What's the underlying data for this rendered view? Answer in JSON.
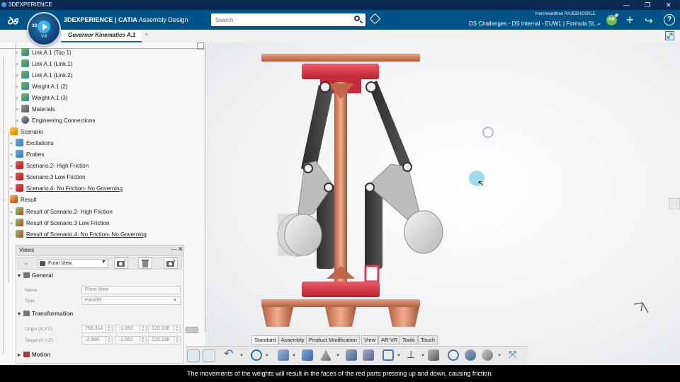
{
  "window": {
    "app_title": "3DEXPERIENCE",
    "minimize": "—",
    "restore": "❐",
    "close": "✕"
  },
  "header": {
    "compass_label": "3D",
    "compass_version": "V.6",
    "brand_prefix": "3DEXPERIENCE | CATIA",
    "brand_app": "Assembly Design",
    "search_placeholder": "Search",
    "user_name": "Harshwardhan RAJEBHOSRLE",
    "collab_space": "DS Challenges - DS Internal - EUW1 | Formula St...",
    "avatar_initials": "HR",
    "add_label": "+",
    "share_label": "↪",
    "help_label": "?"
  },
  "tabs": {
    "document_tab": "Governor Kinematics A.1",
    "add_tab": "+"
  },
  "tree": {
    "items": [
      {
        "label": "Link A.1 (Top 1)",
        "icon": "part"
      },
      {
        "label": "Link A.1 (Link.1)",
        "icon": "part"
      },
      {
        "label": "Link A.1 (Link.2)",
        "icon": "part"
      },
      {
        "label": "Weight A.1 (2)",
        "icon": "part"
      },
      {
        "label": "Weight A.1 (3)",
        "icon": "part"
      },
      {
        "label": "Materials",
        "icon": "materials"
      },
      {
        "label": "Engineering Connections",
        "icon": "engineering-connections"
      },
      {
        "label": "Scenario",
        "icon": "scenario"
      },
      {
        "label": "Excitations",
        "icon": "excitations"
      },
      {
        "label": "Probes",
        "icon": "probes"
      },
      {
        "label": "Scenario.2- High Friction",
        "icon": "scenario-item"
      },
      {
        "label": "Scenario.3 Low Friction",
        "icon": "scenario-item"
      },
      {
        "label": "Scenario.4- No Friction- No Governing",
        "icon": "scenario-item"
      },
      {
        "label": "Result",
        "icon": "result"
      },
      {
        "label": "Result of Scenario.2- High Friction",
        "icon": "result-item"
      },
      {
        "label": "Result of Scenario.3 Low Friction",
        "icon": "result-item"
      },
      {
        "label": "Result of Scenario.4- No Friction- No Governing",
        "icon": "result-item"
      }
    ]
  },
  "views_panel": {
    "title": "Views",
    "minimize": "—",
    "close": "✕",
    "view_select": "Front View",
    "general_section": "General",
    "name_label": "Name",
    "name_value": "Front View",
    "type_label": "Type",
    "type_value": "Parallel",
    "transformation_section": "Transformation",
    "origin_label": "Origin (X,Y,Z)",
    "origin_values": [
      "756.314",
      "-1.092",
      "120.238"
    ],
    "target_label": "Target (X,Y,Z)",
    "target_values": [
      "-2.588",
      "-1.092",
      "120.238"
    ],
    "motion_section": "Motion"
  },
  "toolbar_tabs": [
    "Standard",
    "Assembly",
    "Product Modification",
    "View",
    "AR-VR",
    "Tools",
    "Touch"
  ],
  "active_toolbar_tab": "Standard",
  "caption": "The movements of the weights will result in the faces of the red parts pressing up and down, causing friction.",
  "colors": {
    "header_blue": "#005386",
    "titlebar_navy": "#0b2b52",
    "copper": "#d9876a",
    "red_parts": "#d93a4a",
    "dark_links": "#3e3e40",
    "avatar_green": "#6cc04a"
  }
}
